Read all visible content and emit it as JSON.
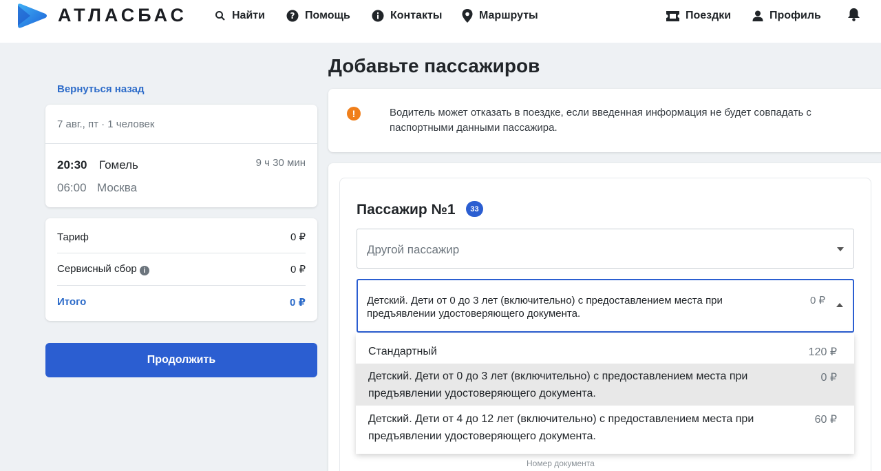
{
  "brand": {
    "name": "АТЛАСБАС",
    "logo_color": "#2b8fe6"
  },
  "nav": {
    "find": "Найти",
    "help": "Помощь",
    "contacts": "Контакты",
    "routes": "Маршруты",
    "trips": "Поездки",
    "profile": "Профиль"
  },
  "back_link": "Вернуться назад",
  "trip": {
    "summary": "7 авг., пт · 1 человек",
    "departure_time": "20:30",
    "departure_city": "Гомель",
    "duration": "9 ч 30 мин",
    "arrival_time": "06:00",
    "arrival_city": "Москва"
  },
  "prices": {
    "tariff_label": "Тариф",
    "tariff_value": "0 ₽",
    "service_label": "Сервисный сбор",
    "service_value": "0 ₽",
    "total_label": "Итого",
    "total_value": "0 ₽"
  },
  "continue_label": "Продолжить",
  "page_title": "Добавьте пассажиров",
  "warning": {
    "icon": "!",
    "text": "Водитель может отказать в поездке, если введенная информация не будет совпадать с паспортными данными пассажира."
  },
  "passenger": {
    "title": "Пассажир №1",
    "badge": "33",
    "select_placeholder": "Другой пассажир",
    "tariff_selected": "Детский. Дети от 0 до 3 лет (включительно) с предоставлением места при предъявлении удостоверяющего документа.",
    "tariff_selected_price": "0 ₽",
    "options": [
      {
        "label": "Стандартный",
        "price": "120 ₽"
      },
      {
        "label": "Детский. Дети от 0 до 3 лет (включительно) с предоставлением места при предъявлении удостоверяющего документа.",
        "price": "0 ₽"
      },
      {
        "label": "Детский. Дети от 4 до 12 лет (включительно) с предоставлением места при предъявлении удостоверяющего документа.",
        "price": "60 ₽"
      }
    ],
    "doc_label": "Номер документа"
  },
  "colors": {
    "accent": "#2b5ed1",
    "link": "#2c6bc9",
    "warning": "#f07f1b",
    "background": "#eef1f4"
  }
}
